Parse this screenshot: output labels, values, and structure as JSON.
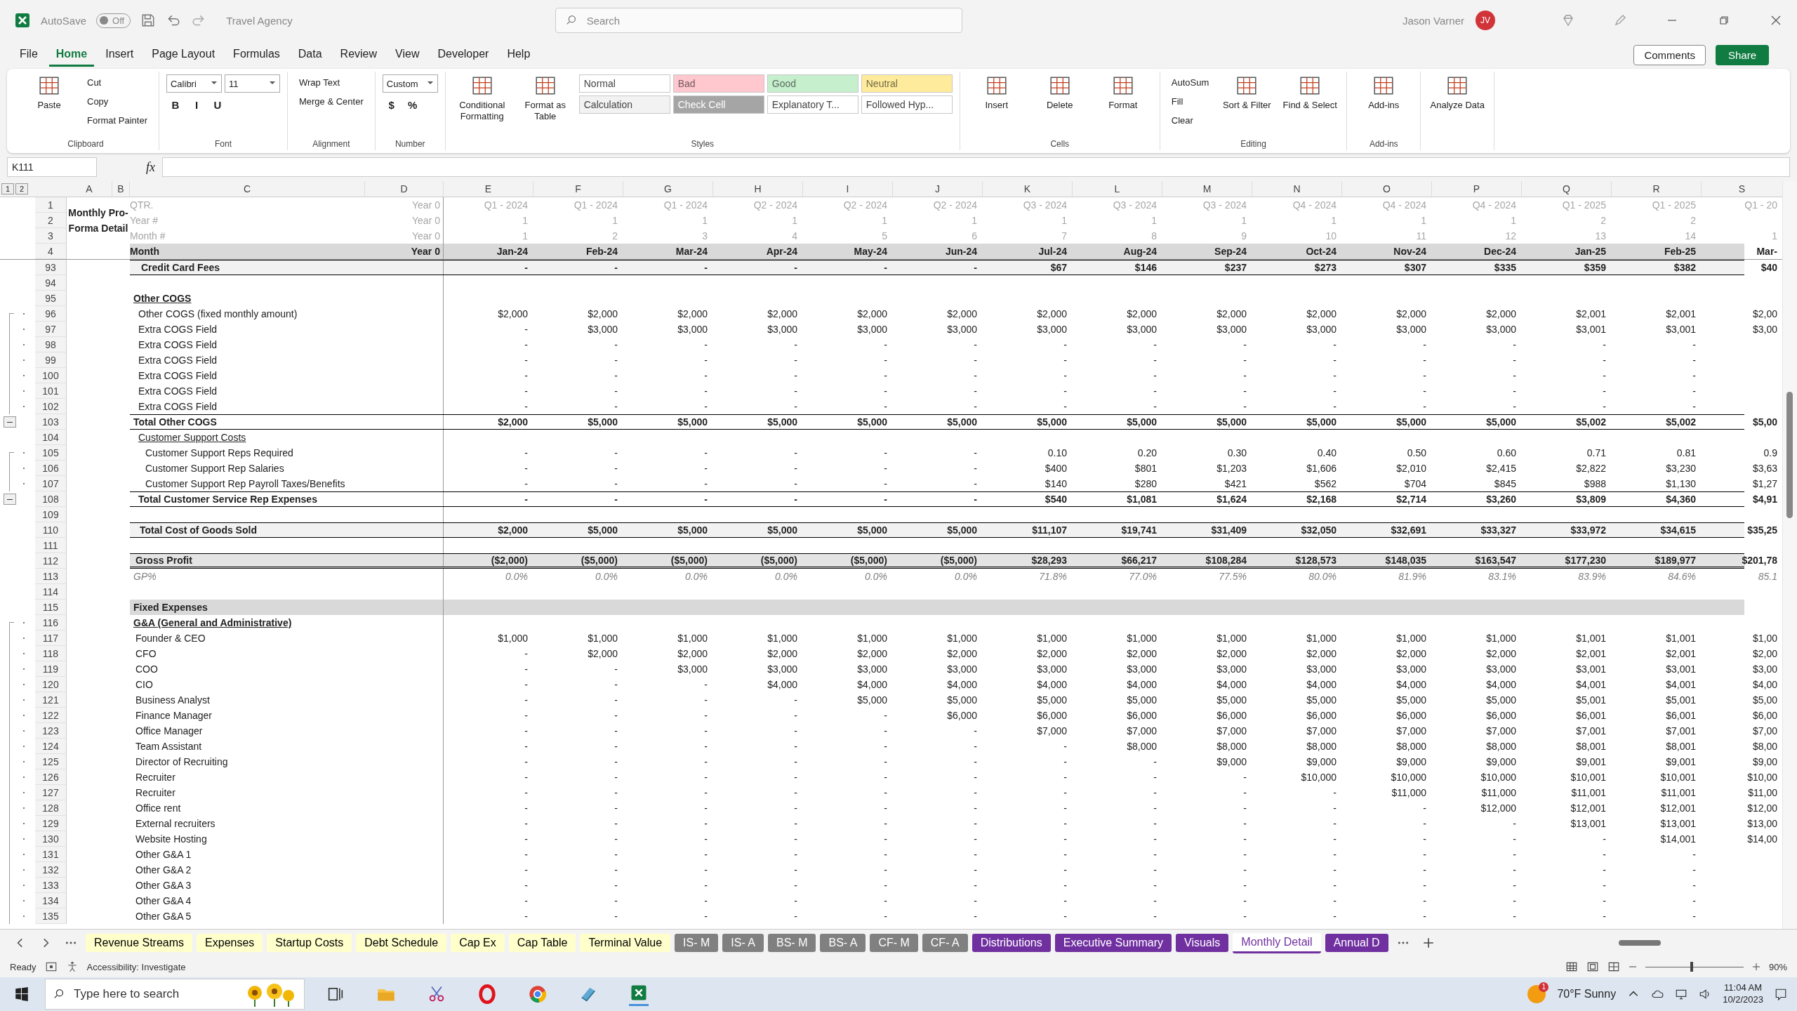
{
  "titlebar": {
    "autosave_label": "AutoSave",
    "autosave": {
      "on": false,
      "text": "Off"
    },
    "document": "Travel Agency",
    "search": {
      "placeholder": "Search"
    },
    "user": "Jason Varner",
    "initials": "JV"
  },
  "menu": {
    "tabs": [
      {
        "label": "File",
        "selected": false
      },
      {
        "label": "Home",
        "selected": true
      },
      {
        "label": "Insert",
        "selected": false
      },
      {
        "label": "Page Layout",
        "selected": false
      },
      {
        "label": "Formulas",
        "selected": false
      },
      {
        "label": "Data",
        "selected": false
      },
      {
        "label": "Review",
        "selected": false
      },
      {
        "label": "View",
        "selected": false
      },
      {
        "label": "Developer",
        "selected": false
      },
      {
        "label": "Help",
        "selected": false
      }
    ],
    "comments": "Comments",
    "share": "Share"
  },
  "ribbon": {
    "groups": [
      {
        "label": "Clipboard",
        "cols": [
          {
            "kind": "large",
            "label": "Paste"
          },
          {
            "kind": "stack",
            "rows": [
              [
                {
                  "kind": "button",
                  "label": "Cut"
                }
              ],
              [
                {
                  "kind": "button",
                  "label": "Copy"
                }
              ],
              [
                {
                  "kind": "button",
                  "label": "Format Painter"
                }
              ]
            ]
          }
        ]
      },
      {
        "label": "Font",
        "cols": [
          {
            "kind": "stack",
            "rows": [
              [
                {
                  "kind": "field",
                  "value": "Calibri"
                },
                {
                  "kind": "field",
                  "value": "11"
                }
              ],
              [
                {
                  "kind": "glyph",
                  "label": "B"
                },
                {
                  "kind": "glyph",
                  "label": "I"
                },
                {
                  "kind": "glyph",
                  "label": "U"
                }
              ]
            ]
          }
        ]
      },
      {
        "label": "Alignment",
        "cols": [
          {
            "kind": "stack",
            "rows": [
              [
                {
                  "kind": "button",
                  "label": "Wrap Text"
                }
              ],
              [
                {
                  "kind": "button",
                  "label": "Merge & Center"
                }
              ]
            ]
          }
        ]
      },
      {
        "label": "Number",
        "cols": [
          {
            "kind": "stack",
            "rows": [
              [
                {
                  "kind": "field",
                  "value": "Custom"
                }
              ],
              [
                {
                  "kind": "glyph",
                  "label": "$"
                },
                {
                  "kind": "glyph",
                  "label": "%"
                }
              ]
            ]
          }
        ]
      },
      {
        "label": "Styles",
        "cols": [
          {
            "kind": "large",
            "label": "Conditional Formatting"
          },
          {
            "kind": "large",
            "label": "Format as Table"
          },
          {
            "kind": "stack",
            "rows": [
              [
                {
                  "kind": "style",
                  "label": "Normal",
                  "color": "#ffffff"
                },
                {
                  "kind": "style",
                  "label": "Bad",
                  "color": "#ffc7ce"
                },
                {
                  "kind": "style",
                  "label": "Good",
                  "color": "#c6efce"
                },
                {
                  "kind": "style",
                  "label": "Neutral",
                  "color": "#ffeb9c"
                }
              ],
              [
                {
                  "kind": "style",
                  "label": "Calculation",
                  "color": "#f2f2f2"
                },
                {
                  "kind": "style",
                  "label": "Check Cell",
                  "color": "#a5a5a5"
                },
                {
                  "kind": "style",
                  "label": "Explanatory T...",
                  "color": "#ffffff"
                },
                {
                  "kind": "style",
                  "label": "Followed Hyp...",
                  "color": "#ffffff"
                }
              ]
            ]
          }
        ]
      },
      {
        "label": "Cells",
        "cols": [
          {
            "kind": "large",
            "label": "Insert"
          },
          {
            "kind": "large",
            "label": "Delete"
          },
          {
            "kind": "large",
            "label": "Format"
          }
        ]
      },
      {
        "label": "Editing",
        "cols": [
          {
            "kind": "stack",
            "rows": [
              [
                {
                  "kind": "button",
                  "label": "AutoSum"
                }
              ],
              [
                {
                  "kind": "button",
                  "label": "Fill"
                }
              ],
              [
                {
                  "kind": "button",
                  "label": "Clear"
                }
              ]
            ]
          },
          {
            "kind": "large",
            "label": "Sort & Filter"
          },
          {
            "kind": "large",
            "label": "Find & Select"
          }
        ]
      },
      {
        "label": "Add-ins",
        "cols": [
          {
            "kind": "large",
            "label": "Add-ins"
          }
        ]
      },
      {
        "cols": [
          {
            "kind": "large",
            "label": "Analyze Data"
          }
        ]
      }
    ]
  },
  "formula_bar": {
    "name_box": "K111",
    "fx": "fx"
  },
  "sheet": {
    "outline_levels": [
      "1",
      "2"
    ],
    "columns": [
      "A",
      "B",
      "C",
      "D",
      "E",
      "F",
      "G",
      "H",
      "I",
      "J",
      "K",
      "L",
      "M",
      "N",
      "O",
      "P",
      "Q",
      "R",
      "S"
    ],
    "title": "Monthly Pro-Forma Detail",
    "header_rows": [
      {
        "n": "1",
        "kind": "meta",
        "label": "QTR.",
        "d": "Year 0",
        "values": [
          "Q1 - 2024",
          "Q1 - 2024",
          "Q1 - 2024",
          "Q2 - 2024",
          "Q2 - 2024",
          "Q2 - 2024",
          "Q3 - 2024",
          "Q3 - 2024",
          "Q3 - 2024",
          "Q4 - 2024",
          "Q4 - 2024",
          "Q4 - 2024",
          "Q1 - 2025",
          "Q1 - 2025",
          "Q1 - 20"
        ]
      },
      {
        "n": "2",
        "kind": "meta",
        "label": "Year #",
        "d": "Year 0",
        "values": [
          "1",
          "1",
          "1",
          "1",
          "1",
          "1",
          "1",
          "1",
          "1",
          "1",
          "1",
          "1",
          "2",
          "2"
        ]
      },
      {
        "n": "3",
        "kind": "meta",
        "label": "Month #",
        "d": "Year 0",
        "values": [
          "1",
          "2",
          "3",
          "4",
          "5",
          "6",
          "7",
          "8",
          "9",
          "10",
          "11",
          "12",
          "13",
          "14",
          "1"
        ]
      },
      {
        "n": "4",
        "kind": "month",
        "label": "Month",
        "d": "Year 0",
        "values": [
          "Jan-24",
          "Feb-24",
          "Mar-24",
          "Apr-24",
          "May-24",
          "Jun-24",
          "Jul-24",
          "Aug-24",
          "Sep-24",
          "Oct-24",
          "Nov-24",
          "Dec-24",
          "Jan-25",
          "Feb-25",
          "Mar-"
        ]
      }
    ],
    "rows": [
      {
        "n": "93",
        "kind": "section",
        "label": "Credit Card Fees",
        "values": [
          "-",
          "-",
          "-",
          "-",
          "-",
          "-",
          "$67",
          "$146",
          "$237",
          "$273",
          "$307",
          "$335",
          "$359",
          "$382",
          "$40"
        ]
      },
      {
        "n": "94",
        "kind": "blank"
      },
      {
        "n": "95",
        "kind": "heading",
        "label": "Other COGS"
      },
      {
        "n": "96",
        "kind": "item",
        "grouped": true,
        "group_start": true,
        "label": "Other COGS (fixed monthly amount)",
        "values": [
          "$2,000",
          "$2,000",
          "$2,000",
          "$2,000",
          "$2,000",
          "$2,000",
          "$2,000",
          "$2,000",
          "$2,000",
          "$2,000",
          "$2,000",
          "$2,000",
          "$2,001",
          "$2,001",
          "$2,00"
        ]
      },
      {
        "n": "97",
        "kind": "item",
        "grouped": true,
        "label": "Extra COGS Field",
        "values": [
          "-",
          "$3,000",
          "$3,000",
          "$3,000",
          "$3,000",
          "$3,000",
          "$3,000",
          "$3,000",
          "$3,000",
          "$3,000",
          "$3,000",
          "$3,000",
          "$3,001",
          "$3,001",
          "$3,00"
        ]
      },
      {
        "n": "98",
        "kind": "item",
        "grouped": true,
        "label": "Extra COGS Field",
        "values": [
          "-",
          "-",
          "-",
          "-",
          "-",
          "-",
          "-",
          "-",
          "-",
          "-",
          "-",
          "-",
          "-",
          "-"
        ]
      },
      {
        "n": "99",
        "kind": "item",
        "grouped": true,
        "label": "Extra COGS Field",
        "values": [
          "-",
          "-",
          "-",
          "-",
          "-",
          "-",
          "-",
          "-",
          "-",
          "-",
          "-",
          "-",
          "-",
          "-"
        ]
      },
      {
        "n": "100",
        "kind": "item",
        "grouped": true,
        "label": "Extra COGS Field",
        "values": [
          "-",
          "-",
          "-",
          "-",
          "-",
          "-",
          "-",
          "-",
          "-",
          "-",
          "-",
          "-",
          "-",
          "-"
        ]
      },
      {
        "n": "101",
        "kind": "item",
        "grouped": true,
        "label": "Extra COGS Field",
        "values": [
          "-",
          "-",
          "-",
          "-",
          "-",
          "-",
          "-",
          "-",
          "-",
          "-",
          "-",
          "-",
          "-",
          "-"
        ]
      },
      {
        "n": "102",
        "kind": "item",
        "grouped": true,
        "label": "Extra COGS Field",
        "values": [
          "-",
          "-",
          "-",
          "-",
          "-",
          "-",
          "-",
          "-",
          "-",
          "-",
          "-",
          "-",
          "-",
          "-"
        ]
      },
      {
        "n": "103",
        "kind": "total",
        "collapsible": true,
        "label": "Total Other COGS",
        "values": [
          "$2,000",
          "$5,000",
          "$5,000",
          "$5,000",
          "$5,000",
          "$5,000",
          "$5,000",
          "$5,000",
          "$5,000",
          "$5,000",
          "$5,000",
          "$5,000",
          "$5,002",
          "$5,002",
          "$5,00"
        ]
      },
      {
        "n": "104",
        "kind": "subheading",
        "label": "Customer Support Costs"
      },
      {
        "n": "105",
        "kind": "item2",
        "grouped": true,
        "group_start": true,
        "label": "Customer Support Reps Required",
        "values": [
          "-",
          "-",
          "-",
          "-",
          "-",
          "-",
          "0.10",
          "0.20",
          "0.30",
          "0.40",
          "0.50",
          "0.60",
          "0.71",
          "0.81",
          "0.9"
        ]
      },
      {
        "n": "106",
        "kind": "item2",
        "grouped": true,
        "label": "Customer Support Rep Salaries",
        "values": [
          "-",
          "-",
          "-",
          "-",
          "-",
          "-",
          "$400",
          "$801",
          "$1,203",
          "$1,606",
          "$2,010",
          "$2,415",
          "$2,822",
          "$3,230",
          "$3,63"
        ]
      },
      {
        "n": "107",
        "kind": "item2",
        "grouped": true,
        "label": "Customer Support Rep Payroll Taxes/Benefits",
        "values": [
          "-",
          "-",
          "-",
          "-",
          "-",
          "-",
          "$140",
          "$280",
          "$421",
          "$562",
          "$704",
          "$845",
          "$988",
          "$1,130",
          "$1,27"
        ]
      },
      {
        "n": "108",
        "kind": "total2",
        "collapsible": true,
        "label": "Total Customer Service Rep Expenses",
        "values": [
          "-",
          "-",
          "-",
          "-",
          "-",
          "-",
          "$540",
          "$1,081",
          "$1,624",
          "$2,168",
          "$2,714",
          "$3,260",
          "$3,809",
          "$4,360",
          "$4,91"
        ]
      },
      {
        "n": "109",
        "kind": "blank"
      },
      {
        "n": "110",
        "kind": "grand",
        "label": "Total Cost of Goods Sold",
        "values": [
          "$2,000",
          "$5,000",
          "$5,000",
          "$5,000",
          "$5,000",
          "$5,000",
          "$11,107",
          "$19,741",
          "$31,409",
          "$32,050",
          "$32,691",
          "$33,327",
          "$33,972",
          "$34,615",
          "$35,25"
        ]
      },
      {
        "n": "111",
        "kind": "blank"
      },
      {
        "n": "112",
        "kind": "gross",
        "label": "Gross Profit",
        "values": [
          "($2,000)",
          "($5,000)",
          "($5,000)",
          "($5,000)",
          "($5,000)",
          "($5,000)",
          "$28,293",
          "$66,217",
          "$108,284",
          "$128,573",
          "$148,035",
          "$163,547",
          "$177,230",
          "$189,977",
          "$201,78"
        ]
      },
      {
        "n": "113",
        "kind": "pct",
        "label": "GP%",
        "values": [
          "0.0%",
          "0.0%",
          "0.0%",
          "0.0%",
          "0.0%",
          "0.0%",
          "71.8%",
          "77.0%",
          "77.5%",
          "80.0%",
          "81.9%",
          "83.1%",
          "83.9%",
          "84.6%",
          "85.1"
        ]
      },
      {
        "n": "114",
        "kind": "blank"
      },
      {
        "n": "115",
        "kind": "band",
        "label": "Fixed Expenses"
      },
      {
        "n": "116",
        "kind": "heading",
        "grouped": true,
        "group_start": true,
        "label": "G&A (General and Administrative)"
      },
      {
        "n": "117",
        "kind": "ga",
        "grouped": true,
        "label": "Founder & CEO",
        "values": [
          "$1,000",
          "$1,000",
          "$1,000",
          "$1,000",
          "$1,000",
          "$1,000",
          "$1,000",
          "$1,000",
          "$1,000",
          "$1,000",
          "$1,000",
          "$1,000",
          "$1,001",
          "$1,001",
          "$1,00"
        ]
      },
      {
        "n": "118",
        "kind": "ga",
        "grouped": true,
        "label": "CFO",
        "values": [
          "-",
          "$2,000",
          "$2,000",
          "$2,000",
          "$2,000",
          "$2,000",
          "$2,000",
          "$2,000",
          "$2,000",
          "$2,000",
          "$2,000",
          "$2,000",
          "$2,001",
          "$2,001",
          "$2,00"
        ]
      },
      {
        "n": "119",
        "kind": "ga",
        "grouped": true,
        "label": "COO",
        "values": [
          "-",
          "-",
          "$3,000",
          "$3,000",
          "$3,000",
          "$3,000",
          "$3,000",
          "$3,000",
          "$3,000",
          "$3,000",
          "$3,000",
          "$3,000",
          "$3,001",
          "$3,001",
          "$3,00"
        ]
      },
      {
        "n": "120",
        "kind": "ga",
        "grouped": true,
        "label": "CIO",
        "values": [
          "-",
          "-",
          "-",
          "$4,000",
          "$4,000",
          "$4,000",
          "$4,000",
          "$4,000",
          "$4,000",
          "$4,000",
          "$4,000",
          "$4,000",
          "$4,001",
          "$4,001",
          "$4,00"
        ]
      },
      {
        "n": "121",
        "kind": "ga",
        "grouped": true,
        "label": "Business Analyst",
        "values": [
          "-",
          "-",
          "-",
          "-",
          "$5,000",
          "$5,000",
          "$5,000",
          "$5,000",
          "$5,000",
          "$5,000",
          "$5,000",
          "$5,000",
          "$5,001",
          "$5,001",
          "$5,00"
        ]
      },
      {
        "n": "122",
        "kind": "ga",
        "grouped": true,
        "label": "Finance Manager",
        "values": [
          "-",
          "-",
          "-",
          "-",
          "-",
          "$6,000",
          "$6,000",
          "$6,000",
          "$6,000",
          "$6,000",
          "$6,000",
          "$6,000",
          "$6,001",
          "$6,001",
          "$6,00"
        ]
      },
      {
        "n": "123",
        "kind": "ga",
        "grouped": true,
        "label": "Office Manager",
        "values": [
          "-",
          "-",
          "-",
          "-",
          "-",
          "-",
          "$7,000",
          "$7,000",
          "$7,000",
          "$7,000",
          "$7,000",
          "$7,000",
          "$7,001",
          "$7,001",
          "$7,00"
        ]
      },
      {
        "n": "124",
        "kind": "ga",
        "grouped": true,
        "label": "Team Assistant",
        "values": [
          "-",
          "-",
          "-",
          "-",
          "-",
          "-",
          "-",
          "$8,000",
          "$8,000",
          "$8,000",
          "$8,000",
          "$8,000",
          "$8,001",
          "$8,001",
          "$8,00"
        ]
      },
      {
        "n": "125",
        "kind": "ga",
        "grouped": true,
        "label": "Director of Recruiting",
        "values": [
          "-",
          "-",
          "-",
          "-",
          "-",
          "-",
          "-",
          "-",
          "$9,000",
          "$9,000",
          "$9,000",
          "$9,000",
          "$9,001",
          "$9,001",
          "$9,00"
        ]
      },
      {
        "n": "126",
        "kind": "ga",
        "grouped": true,
        "label": "Recruiter",
        "values": [
          "-",
          "-",
          "-",
          "-",
          "-",
          "-",
          "-",
          "-",
          "-",
          "$10,000",
          "$10,000",
          "$10,000",
          "$10,001",
          "$10,001",
          "$10,00"
        ]
      },
      {
        "n": "127",
        "kind": "ga",
        "grouped": true,
        "label": "Recruiter",
        "values": [
          "-",
          "-",
          "-",
          "-",
          "-",
          "-",
          "-",
          "-",
          "-",
          "-",
          "$11,000",
          "$11,000",
          "$11,001",
          "$11,001",
          "$11,00"
        ]
      },
      {
        "n": "128",
        "kind": "ga",
        "grouped": true,
        "label": "Office rent",
        "values": [
          "-",
          "-",
          "-",
          "-",
          "-",
          "-",
          "-",
          "-",
          "-",
          "-",
          "-",
          "$12,000",
          "$12,001",
          "$12,001",
          "$12,00"
        ]
      },
      {
        "n": "129",
        "kind": "ga",
        "grouped": true,
        "label": "External recruiters",
        "values": [
          "-",
          "-",
          "-",
          "-",
          "-",
          "-",
          "-",
          "-",
          "-",
          "-",
          "-",
          "-",
          "$13,001",
          "$13,001",
          "$13,00"
        ]
      },
      {
        "n": "130",
        "kind": "ga",
        "grouped": true,
        "label": "Website Hosting",
        "values": [
          "-",
          "-",
          "-",
          "-",
          "-",
          "-",
          "-",
          "-",
          "-",
          "-",
          "-",
          "-",
          "-",
          "$14,001",
          "$14,00"
        ]
      },
      {
        "n": "131",
        "kind": "ga",
        "grouped": true,
        "label": "Other G&A 1",
        "values": [
          "-",
          "-",
          "-",
          "-",
          "-",
          "-",
          "-",
          "-",
          "-",
          "-",
          "-",
          "-",
          "-",
          "-"
        ]
      },
      {
        "n": "132",
        "kind": "ga",
        "grouped": true,
        "label": "Other G&A 2",
        "values": [
          "-",
          "-",
          "-",
          "-",
          "-",
          "-",
          "-",
          "-",
          "-",
          "-",
          "-",
          "-",
          "-",
          "-"
        ]
      },
      {
        "n": "133",
        "kind": "ga",
        "grouped": true,
        "label": "Other G&A 3",
        "values": [
          "-",
          "-",
          "-",
          "-",
          "-",
          "-",
          "-",
          "-",
          "-",
          "-",
          "-",
          "-",
          "-",
          "-"
        ]
      },
      {
        "n": "134",
        "kind": "ga",
        "grouped": true,
        "label": "Other G&A 4",
        "values": [
          "-",
          "-",
          "-",
          "-",
          "-",
          "-",
          "-",
          "-",
          "-",
          "-",
          "-",
          "-",
          "-",
          "-"
        ]
      },
      {
        "n": "135",
        "kind": "ga",
        "grouped": true,
        "label": "Other G&A 5",
        "values": [
          "-",
          "-",
          "-",
          "-",
          "-",
          "-",
          "-",
          "-",
          "-",
          "-",
          "-",
          "-",
          "-",
          "-"
        ]
      }
    ]
  },
  "sheet_tabs": [
    {
      "label": "Revenue Streams",
      "color": "#ffffcc",
      "selected": false
    },
    {
      "label": "Expenses",
      "color": "#ffffcc",
      "selected": false
    },
    {
      "label": "Startup Costs",
      "color": "#ffffcc",
      "selected": false
    },
    {
      "label": "Debt Schedule",
      "color": "#ffffcc",
      "selected": false
    },
    {
      "label": "Cap Ex",
      "color": "#ffffcc",
      "selected": false
    },
    {
      "label": "Cap Table",
      "color": "#ffffcc",
      "selected": false
    },
    {
      "label": "Terminal Value",
      "color": "#ffffcc",
      "selected": false
    },
    {
      "label": "IS- M",
      "color": "#808080",
      "selected": false
    },
    {
      "label": "IS- A",
      "color": "#808080",
      "selected": false
    },
    {
      "label": "BS- M",
      "color": "#808080",
      "selected": false
    },
    {
      "label": "BS- A",
      "color": "#808080",
      "selected": false
    },
    {
      "label": "CF- M",
      "color": "#808080",
      "selected": false
    },
    {
      "label": "CF- A",
      "color": "#808080",
      "selected": false
    },
    {
      "label": "Distributions",
      "color": "#7030a0",
      "selected": false
    },
    {
      "label": "Executive Summary",
      "color": "#7030a0",
      "selected": false
    },
    {
      "label": "Visuals",
      "color": "#7030a0",
      "selected": false
    },
    {
      "label": "Monthly Detail",
      "color": "#7030a0",
      "selected": true
    },
    {
      "label": "Annual D",
      "color": "#7030a0",
      "selected": false
    }
  ],
  "status_bar": {
    "ready": "Ready",
    "accessibility": "Accessibility: Investigate",
    "zoom": {
      "level": 0.47,
      "text": "90%"
    }
  },
  "taskbar": {
    "search": {
      "placeholder": "Type here to search"
    },
    "weather": "70°F  Sunny",
    "badge": "1",
    "time": "11:04 AM",
    "date": "10/2/2023"
  }
}
